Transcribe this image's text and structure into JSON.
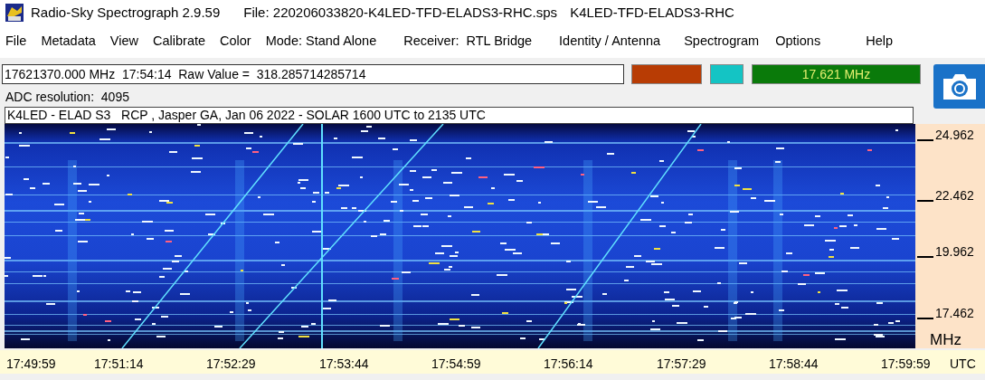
{
  "window": {
    "title": "Radio-Sky Spectrograph 2.9.59",
    "file": "File: 220206033820-K4LED-TFD-ELADS3-RHC.sps",
    "station": "K4LED-TFD-ELADS3-RHC"
  },
  "menu": [
    "File",
    "Metadata",
    "View",
    "Calibrate",
    "Color",
    "Mode: Stand Alone",
    "Receiver:  RTL Bridge",
    "Identity / Antenna",
    "Spectrogram",
    "Options",
    "Help"
  ],
  "readout": {
    "value": "17621370.000 MHz  17:54:14  Raw Value =  318.285714285714"
  },
  "indicators": [
    {
      "color": "#b83c04"
    },
    {
      "color": "#14c4c4"
    },
    {
      "color": "#0a7a0a",
      "text": "17.621 MHz"
    }
  ],
  "adc_resolution": "ADC resolution:  4095",
  "chart_title": "K4LED - ELAD S3   RCP , Jasper GA, Jan 06 2022 - SOLAR 1600 UTC to 2135 UTC",
  "frequency_axis": {
    "ticks": [
      "24.962",
      "22.462",
      "19.962",
      "17.462"
    ],
    "unit": "MHz"
  },
  "time_axis": {
    "ticks": [
      "17:49:59",
      "17:51:14",
      "17:52:29",
      "17:53:44",
      "17:54:59",
      "17:56:14",
      "17:57:29",
      "17:58:44",
      "17:59:59"
    ],
    "unit": "UTC"
  }
}
